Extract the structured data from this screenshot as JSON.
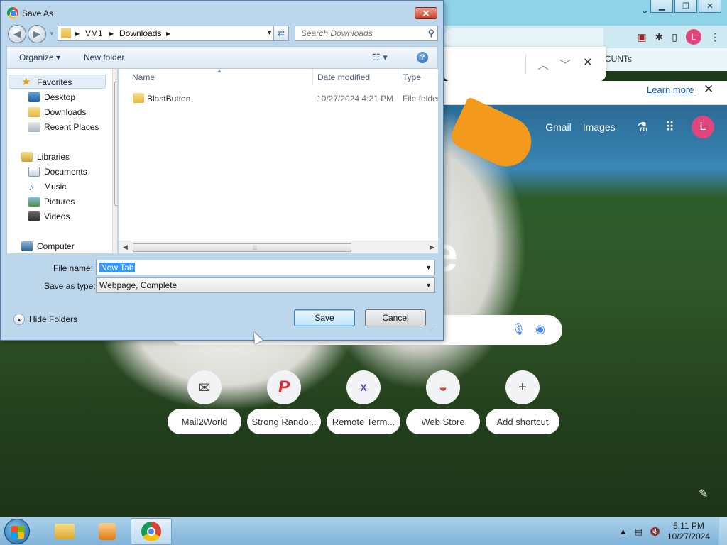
{
  "dialog": {
    "title": "Save As",
    "close_glyph": "✕",
    "address": {
      "crumbs": [
        "VM1",
        "Downloads"
      ]
    },
    "search_placeholder": "Search Downloads",
    "toolbar": {
      "organize": "Organize ▾",
      "new_folder": "New folder"
    },
    "nav_tree": {
      "favorites": "Favorites",
      "favorites_items": [
        "Desktop",
        "Downloads",
        "Recent Places"
      ],
      "libraries": "Libraries",
      "libraries_items": [
        "Documents",
        "Music",
        "Pictures",
        "Videos"
      ],
      "computer": "Computer"
    },
    "columns": {
      "name": "Name",
      "date": "Date modified",
      "type": "Type"
    },
    "files": [
      {
        "name": "BlastButton",
        "date": "10/27/2024 4:21 PM",
        "type": "File folder"
      }
    ],
    "file_name_label": "File name:",
    "file_name_value": "New Tab",
    "save_type_label": "Save as type:",
    "save_type_value": "Webpage, Complete",
    "hide_folders": "Hide Folders",
    "save_button": "Save",
    "cancel_button": "Cancel"
  },
  "browser": {
    "bookmark_tail": "CUNTs",
    "info_bar": {
      "learn_more": "Learn more",
      "close_glyph": "✕"
    },
    "ntp": {
      "gmail": "Gmail",
      "images": "Images",
      "avatar": "L",
      "logo_tail": "e",
      "shortcuts": [
        {
          "label": "Mail2World",
          "icon": "mail-icon",
          "glyph": "✉",
          "color": "#333333"
        },
        {
          "label": "Strong Rando...",
          "icon": "p-logo-icon",
          "glyph": "P",
          "color": "#e0202a"
        },
        {
          "label": "Remote Term...",
          "icon": "x-logo-icon",
          "glyph": "X",
          "color": "#6a3fb5"
        },
        {
          "label": "Web Store",
          "icon": "webstore-icon",
          "glyph": "◒",
          "color": "#d14b3a"
        },
        {
          "label": "Add shortcut",
          "icon": "plus-icon",
          "glyph": "+",
          "color": "#333333"
        }
      ]
    }
  },
  "taskbar": {
    "time": "5:11 PM",
    "date": "10/27/2024"
  },
  "colors": {
    "accent": "#3399ff",
    "avatar": "#e0457b"
  }
}
